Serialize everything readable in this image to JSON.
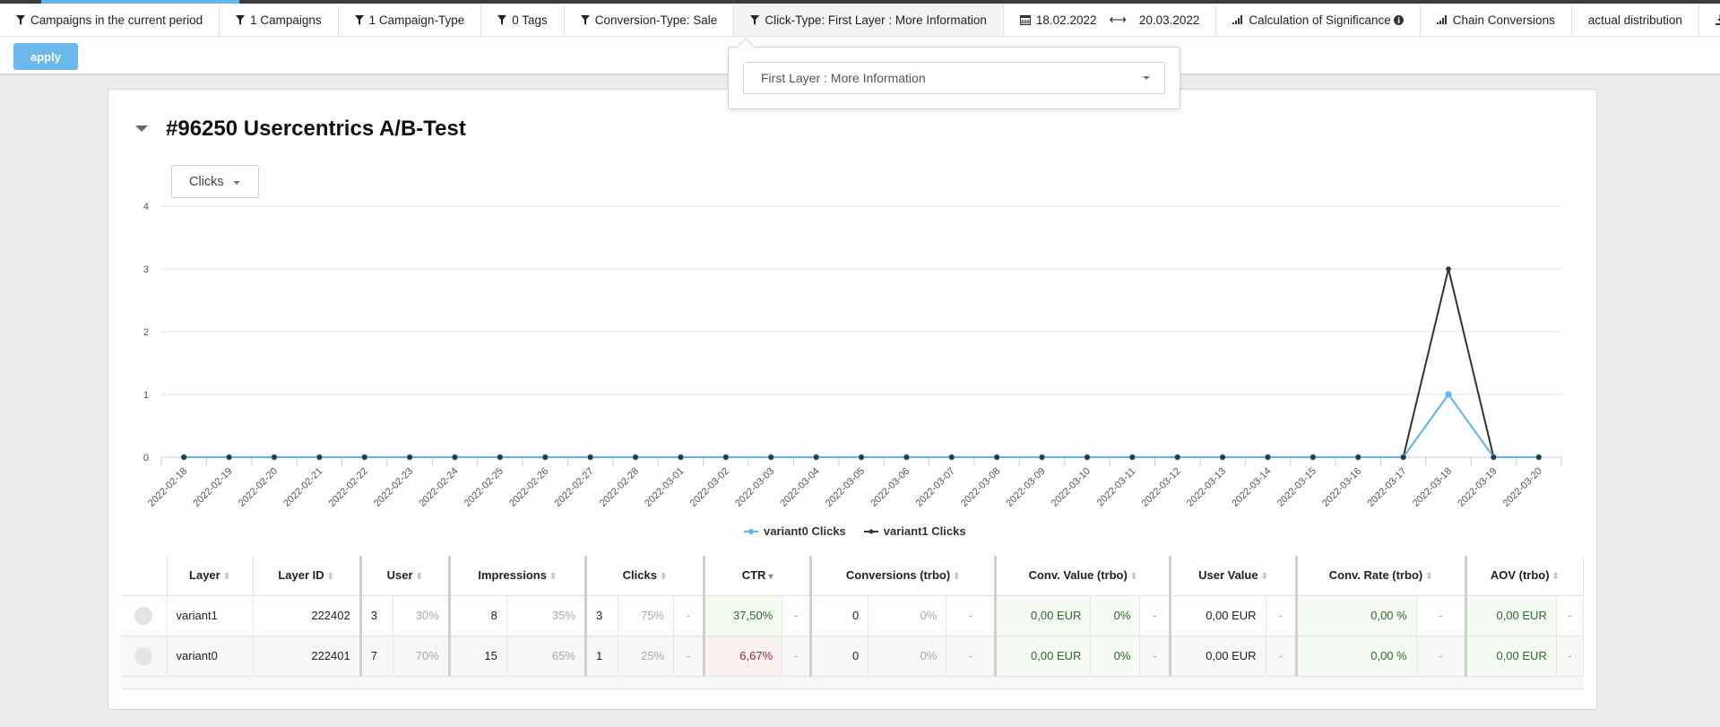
{
  "top_progress": 0.115,
  "filters": [
    {
      "icon": "filter-icon",
      "label": "Campaigns in the current period"
    },
    {
      "icon": "filter-icon",
      "label": "1 Campaigns"
    },
    {
      "icon": "filter-icon",
      "label": "1 Campaign-Type"
    },
    {
      "icon": "filter-icon",
      "label": "0 Tags"
    },
    {
      "icon": "filter-icon",
      "label": "Conversion-Type: Sale"
    },
    {
      "icon": "filter-icon",
      "label": "Click-Type: First Layer : More Information",
      "active": true
    }
  ],
  "date_range": {
    "icon": "calendar-icon",
    "start": "18.02.2022",
    "separator_icon": "arrows-horizontal-icon",
    "end": "20.03.2022"
  },
  "toolbar": {
    "significance": {
      "icon": "signal-bars-icon",
      "label": "Calculation of Significance",
      "info_icon": "info-circle-icon"
    },
    "chain": {
      "icon": "signal-bars-icon",
      "label": "Chain Conversions"
    },
    "distribution": {
      "label": "actual distribution"
    },
    "download": {
      "icon": "download-icon"
    }
  },
  "apply_label": "apply",
  "popover": {
    "selected": "First Layer : More Information"
  },
  "card": {
    "title": "#96250 Usercentrics A/B-Test",
    "metric_selected": "Clicks"
  },
  "chart_data": {
    "type": "line",
    "title": "",
    "xlabel": "",
    "ylabel": "",
    "ylim": [
      0,
      4
    ],
    "yticks": [
      "0",
      "1",
      "2",
      "3",
      "4"
    ],
    "grid": true,
    "legend_position": "bottom-center",
    "x": [
      "2022-02-18",
      "2022-02-19",
      "2022-02-20",
      "2022-02-21",
      "2022-02-22",
      "2022-02-23",
      "2022-02-24",
      "2022-02-25",
      "2022-02-26",
      "2022-02-27",
      "2022-02-28",
      "2022-03-01",
      "2022-03-02",
      "2022-03-03",
      "2022-03-04",
      "2022-03-05",
      "2022-03-06",
      "2022-03-07",
      "2022-03-08",
      "2022-03-09",
      "2022-03-10",
      "2022-03-11",
      "2022-03-12",
      "2022-03-13",
      "2022-03-14",
      "2022-03-15",
      "2022-03-16",
      "2022-03-17",
      "2022-03-18",
      "2022-03-19",
      "2022-03-20"
    ],
    "series": [
      {
        "name": "variant0 Clicks",
        "color": "#5db4ea",
        "values": [
          0,
          0,
          0,
          0,
          0,
          0,
          0,
          0,
          0,
          0,
          0,
          0,
          0,
          0,
          0,
          0,
          0,
          0,
          0,
          0,
          0,
          0,
          0,
          0,
          0,
          0,
          0,
          0,
          1,
          0,
          0
        ]
      },
      {
        "name": "variant1 Clicks",
        "color": "#333333",
        "values": [
          0,
          0,
          0,
          0,
          0,
          0,
          0,
          0,
          0,
          0,
          0,
          0,
          0,
          0,
          0,
          0,
          0,
          0,
          0,
          0,
          0,
          0,
          0,
          0,
          0,
          0,
          0,
          0,
          3,
          0,
          0
        ]
      }
    ]
  },
  "table": {
    "headers": [
      "Layer",
      "Layer ID",
      "User",
      "Impressions",
      "Clicks",
      "CTR",
      "Conversions (trbo)",
      "Conv. Value (trbo)",
      "User Value",
      "Conv. Rate (trbo)",
      "AOV (trbo)"
    ],
    "rows": [
      {
        "layer": "variant1",
        "layer_id": "222402",
        "user": "3",
        "user_pct": "30%",
        "impressions": "8",
        "impressions_pct": "35%",
        "clicks": "3",
        "clicks_pct": "75%",
        "clicks_sig": "-",
        "ctr": "37,50%",
        "ctr_sig": "-",
        "conversions": "0",
        "conversions_pct": "0%",
        "conversions_sig": "-",
        "conv_value": "0,00 EUR",
        "conv_value_pct": "0%",
        "conv_value_sig": "-",
        "user_value": "0,00 EUR",
        "user_value_sig": "-",
        "conv_rate": "0,00 %",
        "conv_rate_sig": "-",
        "aov": "0,00 EUR",
        "aov_sig": "-"
      },
      {
        "layer": "variant0",
        "layer_id": "222401",
        "user": "7",
        "user_pct": "70%",
        "impressions": "15",
        "impressions_pct": "65%",
        "clicks": "1",
        "clicks_pct": "25%",
        "clicks_sig": "-",
        "ctr": "6,67%",
        "ctr_sig": "-",
        "conversions": "0",
        "conversions_pct": "0%",
        "conversions_sig": "-",
        "conv_value": "0,00 EUR",
        "conv_value_pct": "0%",
        "conv_value_sig": "-",
        "user_value": "0,00 EUR",
        "user_value_sig": "-",
        "conv_rate": "0,00 %",
        "conv_rate_sig": "-",
        "aov": "0,00 EUR",
        "aov_sig": "-"
      }
    ]
  }
}
